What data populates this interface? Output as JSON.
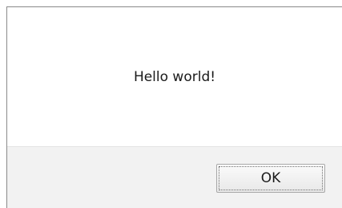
{
  "dialog": {
    "message": "Hello world!",
    "ok_label": "OK"
  }
}
